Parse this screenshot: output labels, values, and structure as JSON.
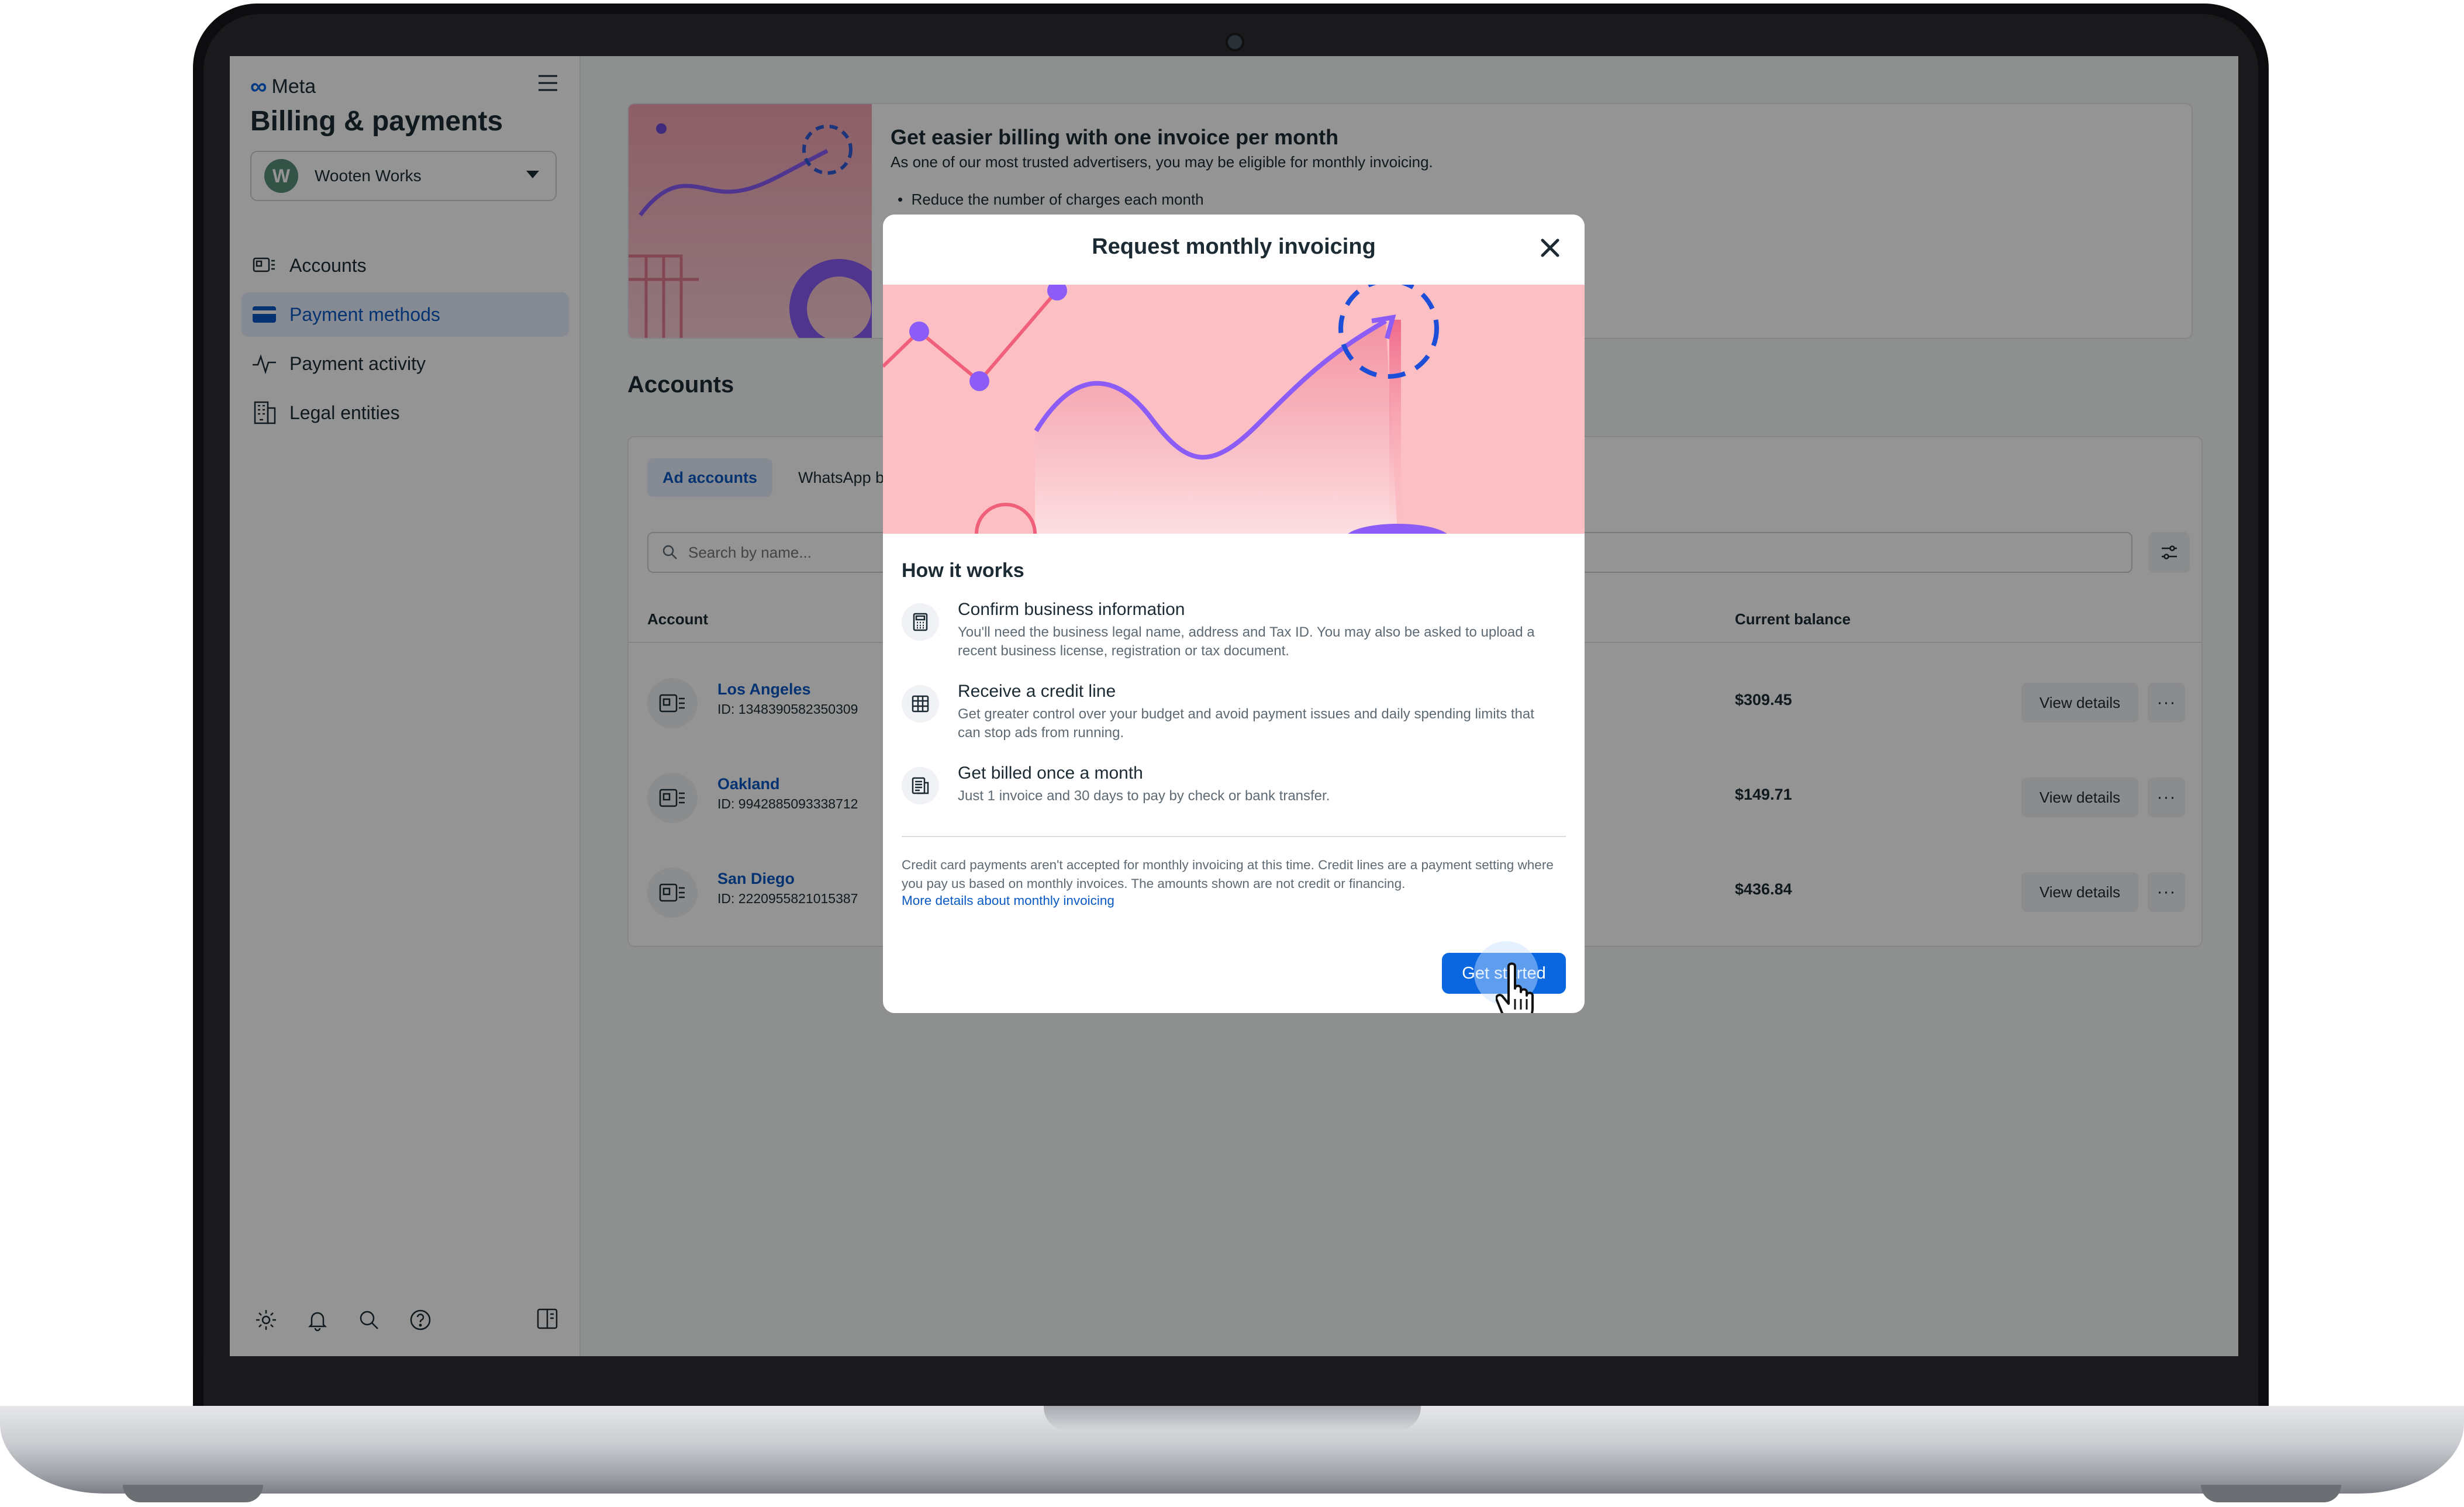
{
  "sidebar": {
    "logo_text": "Meta",
    "title": "Billing & payments",
    "business": {
      "avatar_letter": "W",
      "name": "Wooten Works"
    },
    "items": [
      {
        "label": "Accounts",
        "icon": "accounts-icon",
        "active": false
      },
      {
        "label": "Payment methods",
        "icon": "card-icon",
        "active": true
      },
      {
        "label": "Payment activity",
        "icon": "activity-icon",
        "active": false
      },
      {
        "label": "Legal entities",
        "icon": "building-icon",
        "active": false
      }
    ],
    "bottom_icons": [
      "gear-icon",
      "bell-icon",
      "search-icon",
      "help-icon",
      "panel-toggle-icon"
    ]
  },
  "promo": {
    "title": "Get easier billing with one invoice per month",
    "subtitle": "As one of our most trusted advertisers, you may be eligible for monthly invoicing.",
    "bullet": "Reduce the number of charges each month"
  },
  "accounts": {
    "section_title": "Accounts",
    "tabs": [
      {
        "label": "Ad accounts",
        "active": true
      },
      {
        "label": "WhatsApp bu",
        "active": false
      }
    ],
    "search_placeholder": "Search by name...",
    "columns": {
      "account": "Account",
      "balance": "Current balance"
    },
    "view_label": "View details",
    "more_label": "···",
    "rows": [
      {
        "name": "Los Angeles",
        "id": "ID: 1348390582350309",
        "balance": "$309.45"
      },
      {
        "name": "Oakland",
        "id": "ID: 9942885093338712",
        "balance": "$149.71"
      },
      {
        "name": "San Diego",
        "id": "ID: 2220955821015387",
        "balance": "$436.84"
      }
    ]
  },
  "modal": {
    "title": "Request monthly invoicing",
    "how_title": "How it works",
    "steps": [
      {
        "icon": "calculator-icon",
        "title": "Confirm business information",
        "desc": "You'll need the business legal name, address and Tax ID. You may also be asked to upload a recent business license, registration or tax document."
      },
      {
        "icon": "table-icon",
        "title": "Receive a credit line",
        "desc": "Get greater control over your budget and avoid payment issues and daily spending limits that can stop ads from running."
      },
      {
        "icon": "bills-icon",
        "title": "Get billed once a month",
        "desc": "Just 1 invoice and 30 days to pay by check or bank transfer."
      }
    ],
    "fine_print": "Credit card payments aren't accepted for monthly invoicing at this time. Credit lines are a payment setting where you pay us based on monthly invoices. The amounts shown are not credit or financing.",
    "fine_link": "More details about monthly invoicing",
    "cta": "Get started"
  },
  "colors": {
    "accent": "#0a67e0",
    "link": "#0a59c4",
    "hero_pink": "#fbbfc4",
    "overlay": "rgba(0,0,0,0.42)"
  }
}
